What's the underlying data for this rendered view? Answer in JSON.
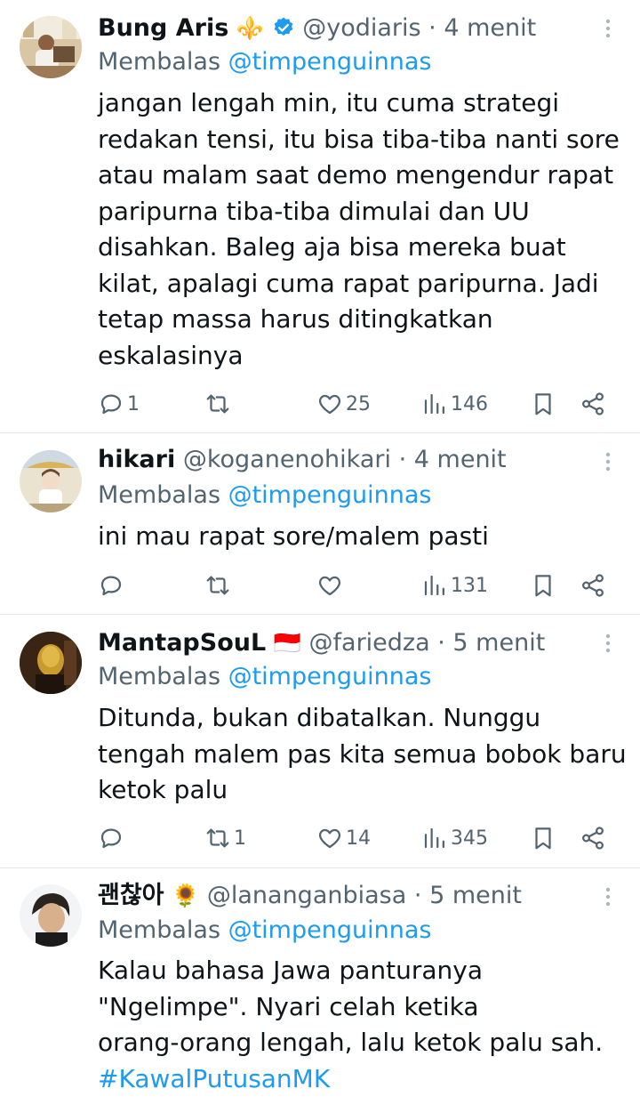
{
  "tweets": [
    {
      "name": "Bung Aris",
      "name_emoji": "⚜️",
      "verified": true,
      "handle": "@yodiaris",
      "time": "4 menit",
      "replying_prefix": "Membalas ",
      "replying_to": "@timpenguinnas",
      "lines": [
        "jangan lengah min, itu cuma strategi",
        "redakan tensi, itu bisa tiba-tiba nanti sore",
        "atau malam saat demo mengendur rapat",
        "paripurna tiba-tiba dimulai dan UU",
        "disahkan. Baleg aja bisa mereka buat",
        "kilat, apalagi cuma rapat paripurna. Jadi",
        "tetap massa harus ditingkatkan",
        "eskalasinya"
      ],
      "replies": "1",
      "retweets": "",
      "likes": "25",
      "views": "146"
    },
    {
      "name": "hikari",
      "name_emoji": "",
      "verified": false,
      "handle": "@koganenohikari",
      "time": "4 menit",
      "replying_prefix": "Membalas ",
      "replying_to": "@timpenguinnas",
      "lines": [
        "ini mau rapat sore/malem pasti"
      ],
      "replies": "",
      "retweets": "",
      "likes": "",
      "views": "131"
    },
    {
      "name": "MantapSouL",
      "name_emoji": "🇮🇩",
      "verified": false,
      "handle": "@fariedza",
      "time": "5 menit",
      "replying_prefix": "Membalas ",
      "replying_to": "@timpenguinnas",
      "lines": [
        "Ditunda, bukan dibatalkan. Nunggu",
        "tengah malem pas kita semua bobok baru",
        "ketok palu"
      ],
      "replies": "",
      "retweets": "1",
      "likes": "14",
      "views": "345"
    },
    {
      "name": "괜찮아",
      "name_emoji": "🌻",
      "verified": false,
      "handle": "@lananganbiasa",
      "time": "5 menit",
      "replying_prefix": "Membalas ",
      "replying_to": "@timpenguinnas",
      "lines": [
        "Kalau bahasa Jawa panturanya",
        "\"Ngelimpe\". Nyari celah ketika",
        "orang-orang lengah, lalu ketok palu sah."
      ],
      "hashtag": "#KawalPutusanMK",
      "replies": "",
      "retweets": "",
      "likes": "",
      "views": ""
    }
  ],
  "colors": {
    "text": "#0f1419",
    "secondary": "#536471",
    "link": "#1d9bf0",
    "divider": "#e6e9ec"
  }
}
